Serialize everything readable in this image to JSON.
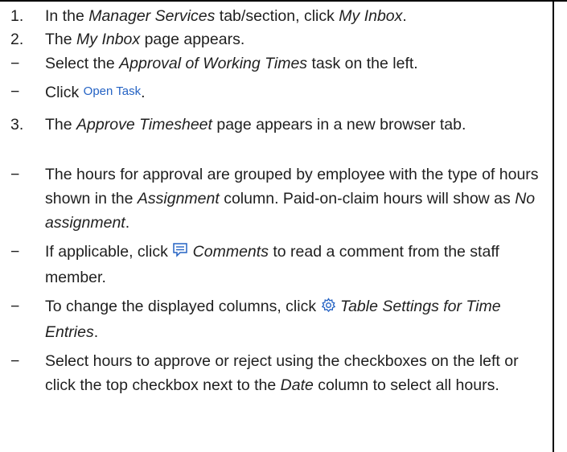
{
  "markers": {
    "s1": "1.",
    "s2": "2.",
    "s3": "3.",
    "dash": "−"
  },
  "step1": {
    "a": "In the ",
    "b": "Manager Services",
    "c": " tab/section, click ",
    "d": "My Inbox",
    "e": "."
  },
  "step2": {
    "a": "The ",
    "b": "My Inbox",
    "c": " page appears."
  },
  "b1": {
    "a": "Select the ",
    "b": "Approval of Working Times",
    "c": " task on the left."
  },
  "b2": {
    "a": "Click ",
    "button": "Open Task",
    "c": "."
  },
  "step3": {
    "a": "The ",
    "b": "Approve Timesheet",
    "c": " page appears in a new browser tab."
  },
  "b3": {
    "a": "The hours for approval are grouped by employee with the type of hours shown in the ",
    "b": "Assignment",
    "c": " column. Paid-on-claim hours will show as ",
    "d": "No assignment",
    "e": "."
  },
  "b4": {
    "a": "If applicable, click ",
    "b": "Comments",
    "c": " to read a comment from the staff member.",
    "icon": "comment-icon"
  },
  "b5": {
    "a": "To change the displayed columns, click ",
    "b": "Table Settings for Time Entries",
    "c": ".",
    "icon": "gear-icon"
  },
  "b6": {
    "a": "Select hours to approve or reject using the checkboxes on the left or click the top checkbox next to the ",
    "b": "Date",
    "c": " column to select all hours."
  },
  "colors": {
    "link": "#2563c4",
    "text": "#1f1f1f",
    "rule": "#000000"
  }
}
